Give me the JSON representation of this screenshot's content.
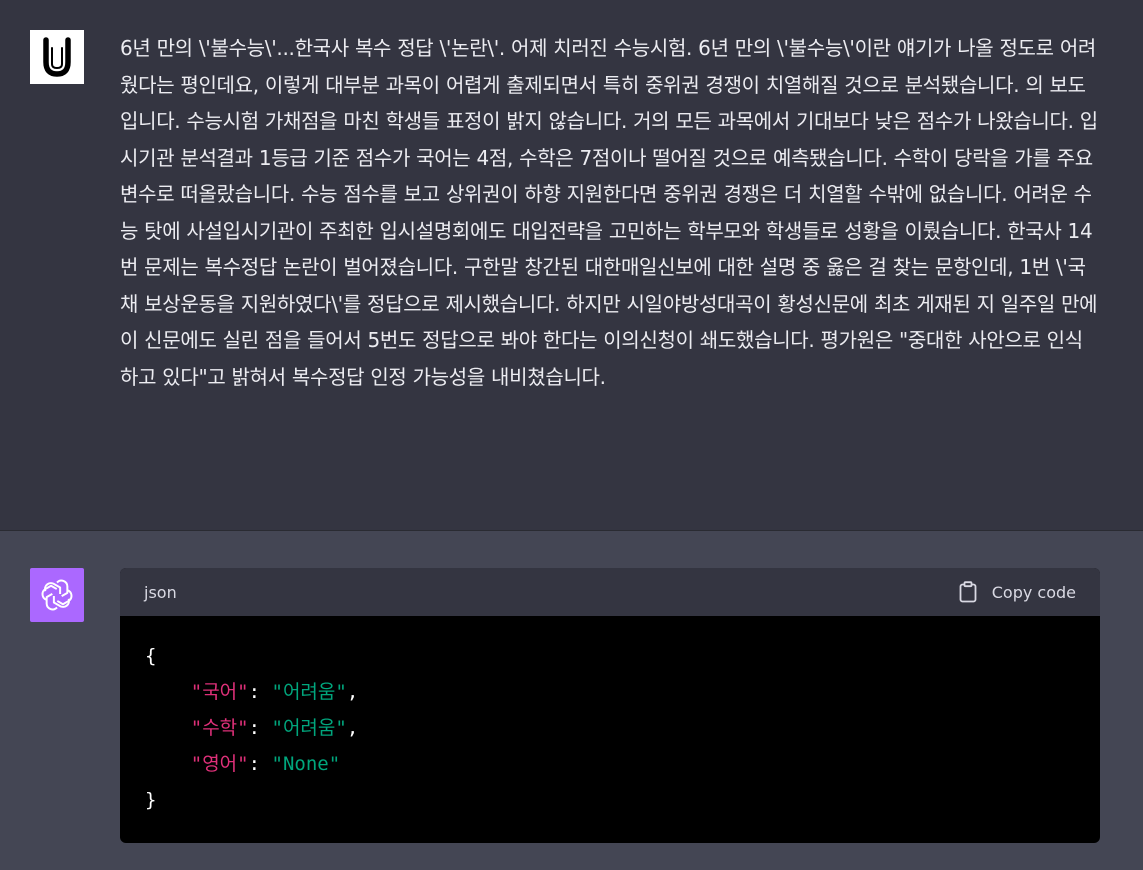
{
  "user": {
    "avatar_letter": "U",
    "message": "6년 만의 \\'불수능\\'...한국사 복수 정답 \\'논란\\'. 어제 치러진 수능시험. 6년 만의 \\'불수능\\'이란 얘기가 나올 정도로 어려웠다는 평인데요, 이렇게 대부분 과목이 어렵게 출제되면서 특히 중위권 경쟁이 치열해질 것으로 분석됐습니다. 의 보도입니다. 수능시험 가채점을 마친 학생들 표정이 밝지 않습니다. 거의 모든 과목에서 기대보다 낮은 점수가 나왔습니다. 입시기관 분석결과 1등급 기준 점수가 국어는 4점, 수학은 7점이나 떨어질 것으로 예측됐습니다. 수학이 당락을 가를 주요 변수로 떠올랐습니다. 수능 점수를 보고 상위권이 하향 지원한다면 중위권 경쟁은 더 치열할 수밖에 없습니다. 어려운 수능 탓에 사설입시기관이 주최한 입시설명회에도 대입전략을 고민하는 학부모와 학생들로 성황을 이뤘습니다. 한국사 14번 문제는 복수정답 논란이 벌어졌습니다. 구한말 창간된 대한매일신보에 대한 설명 중 옳은 걸 찾는 문항인데, 1번 \\'국채 보상운동을 지원하였다\\'를 정답으로 제시했습니다. 하지만 시일야방성대곡이 황성신문에 최초 게재된 지 일주일 만에 이 신문에도 실린 점을 들어서 5번도 정답으로 봐야 한다는 이의신청이 쇄도했습니다. 평가원은 \"중대한 사안으로 인식하고 있다\"고 밝혀서 복수정답 인정 가능성을 내비쳤습니다."
  },
  "assistant": {
    "code_block": {
      "language": "json",
      "copy_label": "Copy code",
      "open_brace": "{",
      "close_brace": "}",
      "entries": [
        {
          "key": "\"국어\"",
          "value": "\"어려움\"",
          "trailing": ","
        },
        {
          "key": "\"수학\"",
          "value": "\"어려움\"",
          "trailing": ","
        },
        {
          "key": "\"영어\"",
          "value": "\"None\"",
          "trailing": ""
        }
      ]
    }
  }
}
